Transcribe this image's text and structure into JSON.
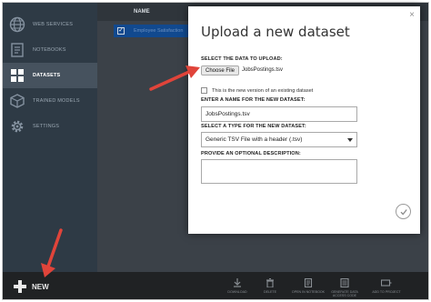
{
  "sidebar": {
    "items": [
      {
        "label": "WEB SERVICES",
        "icon": "globe-icon"
      },
      {
        "label": "NOTEBOOKS",
        "icon": "notebook-icon"
      },
      {
        "label": "DATASETS",
        "icon": "datasets-icon"
      },
      {
        "label": "TRAINED MODELS",
        "icon": "cube-icon"
      },
      {
        "label": "SETTINGS",
        "icon": "gear-icon"
      }
    ]
  },
  "list": {
    "column_header": "NAME",
    "selected_row_text": "Employee Satisfaction"
  },
  "modal": {
    "title": "Upload a new dataset",
    "close_glyph": "×",
    "select_data_label": "SELECT THE DATA TO UPLOAD:",
    "choose_file_label": "Choose File",
    "chosen_file": "JobsPostings.tsv",
    "new_version_label": "This is the new version of an existing dataset",
    "name_label": "ENTER A NAME FOR THE NEW DATASET:",
    "name_value": "JobsPostings.tsv",
    "type_label": "SELECT A TYPE FOR THE NEW DATASET:",
    "type_value": "Generic TSV File with a header (.tsv)",
    "description_label": "PROVIDE AN OPTIONAL DESCRIPTION:"
  },
  "bottombar": {
    "new_label": "NEW",
    "commands": [
      {
        "label": "DOWNLOAD",
        "icon": "download-icon"
      },
      {
        "label": "DELETE",
        "icon": "trash-icon"
      },
      {
        "label": "OPEN IN NOTEBOOK",
        "icon": "notebook-icon"
      },
      {
        "label": "GENERATE DATA ACCESS CODE",
        "icon": "code-icon"
      },
      {
        "label": "ADD TO PROJECT",
        "icon": "project-icon"
      }
    ]
  },
  "colors": {
    "sidebar": "#2e3a45",
    "sidebar_active": "#46525e",
    "selected_row": "#11498f",
    "arrow": "#e0443a",
    "bottombar": "#202224"
  }
}
